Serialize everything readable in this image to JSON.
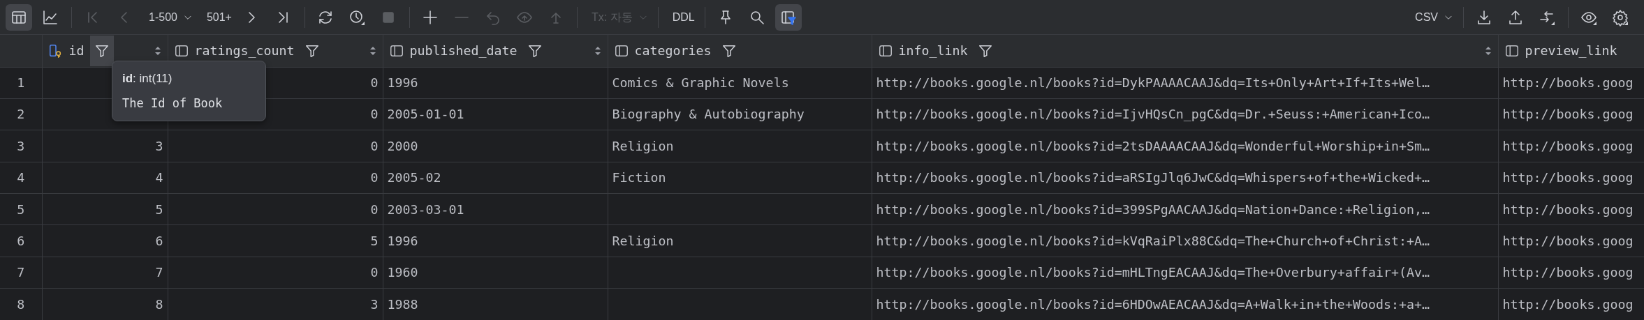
{
  "toolbar_left": [
    {
      "kind": "icon",
      "selected": true,
      "disabled": false
    },
    {
      "kind": "icon",
      "selected": false,
      "disabled": false
    },
    {
      "kind": "separator"
    },
    {
      "kind": "icon",
      "selected": false,
      "disabled": true
    },
    {
      "kind": "icon",
      "selected": false,
      "disabled": true
    },
    {
      "kind": "dropdown",
      "label": "1-500",
      "disabled": false
    },
    {
      "kind": "text",
      "label": "501+",
      "disabled": false
    },
    {
      "kind": "icon",
      "selected": false,
      "disabled": false
    },
    {
      "kind": "icon",
      "selected": false,
      "disabled": false
    },
    {
      "kind": "separator"
    },
    {
      "kind": "icon",
      "selected": false,
      "disabled": false
    },
    {
      "kind": "icon",
      "selected": false,
      "disabled": false
    },
    {
      "kind": "icon",
      "selected": false,
      "disabled": true
    },
    {
      "kind": "separator"
    },
    {
      "kind": "icon",
      "selected": false,
      "disabled": false
    },
    {
      "kind": "icon",
      "selected": false,
      "disabled": true
    },
    {
      "kind": "icon",
      "selected": false,
      "disabled": true
    },
    {
      "kind": "icon",
      "selected": false,
      "disabled": true
    },
    {
      "kind": "icon",
      "selected": false,
      "disabled": true
    },
    {
      "kind": "separator"
    },
    {
      "kind": "dropdown",
      "label": "Tx: 자동",
      "disabled": true
    },
    {
      "kind": "separator"
    },
    {
      "kind": "text",
      "label": "DDL",
      "disabled": false
    },
    {
      "kind": "separator"
    },
    {
      "kind": "icon",
      "selected": false,
      "disabled": false
    },
    {
      "kind": "icon",
      "selected": false,
      "disabled": false
    },
    {
      "kind": "icon",
      "selected": true,
      "disabled": false
    }
  ],
  "toolbar_right": [
    {
      "kind": "dropdown",
      "label": "CSV",
      "disabled": false
    },
    {
      "kind": "separator"
    },
    {
      "kind": "icon",
      "selected": false,
      "disabled": false
    },
    {
      "kind": "icon",
      "selected": false,
      "disabled": false
    },
    {
      "kind": "icon",
      "selected": false,
      "disabled": false
    },
    {
      "kind": "separator"
    },
    {
      "kind": "icon",
      "selected": false,
      "disabled": false
    },
    {
      "kind": "icon",
      "selected": false,
      "disabled": false
    }
  ],
  "table": {
    "columns": [
      {
        "name": "id",
        "kind": "key",
        "filter": true,
        "filter_hovered": true,
        "sort": true
      },
      {
        "name": "ratings_count",
        "kind": "column",
        "filter": true,
        "filter_hovered": false,
        "sort": true
      },
      {
        "name": "published_date",
        "kind": "column",
        "filter": true,
        "filter_hovered": false,
        "sort": true
      },
      {
        "name": "categories",
        "kind": "column",
        "filter": true,
        "filter_hovered": false,
        "sort": false
      },
      {
        "name": "info_link",
        "kind": "column",
        "filter": true,
        "filter_hovered": false,
        "sort": true
      },
      {
        "name": "preview_link",
        "kind": "column",
        "filter": false,
        "sort": false
      }
    ],
    "rows": [
      {
        "number": "1",
        "cells": [
          null,
          "0",
          "1996",
          "Comics & Graphic Novels",
          "http://books.google.nl/books?id=DykPAAAACAAJ&dq=Its+Only+Art+If+Its+Wel…",
          "http://books.goog"
        ]
      },
      {
        "number": "2",
        "cells": [
          null,
          "0",
          "2005-01-01",
          "Biography & Autobiography",
          "http://books.google.nl/books?id=IjvHQsCn_pgC&dq=Dr.+Seuss:+American+Ico…",
          "http://books.goog"
        ]
      },
      {
        "number": "3",
        "cells": [
          "3",
          "0",
          "2000",
          "Religion",
          "http://books.google.nl/books?id=2tsDAAAACAAJ&dq=Wonderful+Worship+in+Sm…",
          "http://books.goog"
        ]
      },
      {
        "number": "4",
        "cells": [
          "4",
          "0",
          "2005-02",
          "Fiction",
          "http://books.google.nl/books?id=aRSIgJlq6JwC&dq=Whispers+of+the+Wicked+…",
          "http://books.goog"
        ]
      },
      {
        "number": "5",
        "cells": [
          "5",
          "0",
          "2003-03-01",
          null,
          "http://books.google.nl/books?id=399SPgAACAAJ&dq=Nation+Dance:+Religion,…",
          "http://books.goog"
        ]
      },
      {
        "number": "6",
        "cells": [
          "6",
          "5",
          "1996",
          "Religion",
          "http://books.google.nl/books?id=kVqRaiPlx88C&dq=The+Church+of+Christ:+A…",
          "http://books.goog"
        ]
      },
      {
        "number": "7",
        "cells": [
          "7",
          "0",
          "1960",
          null,
          "http://books.google.nl/books?id=mHLTngEACAAJ&dq=The+Overbury+affair+(Av…",
          "http://books.goog"
        ]
      },
      {
        "number": "8",
        "cells": [
          "8",
          "3",
          "1988",
          null,
          "http://books.google.nl/books?id=6HDOwAEACAAJ&dq=A+Walk+in+the+Woods:+a+…",
          "http://books.goog"
        ]
      }
    ]
  },
  "tooltip": {
    "signature": "**id**: int(11)",
    "comment": "The Id of Book"
  }
}
